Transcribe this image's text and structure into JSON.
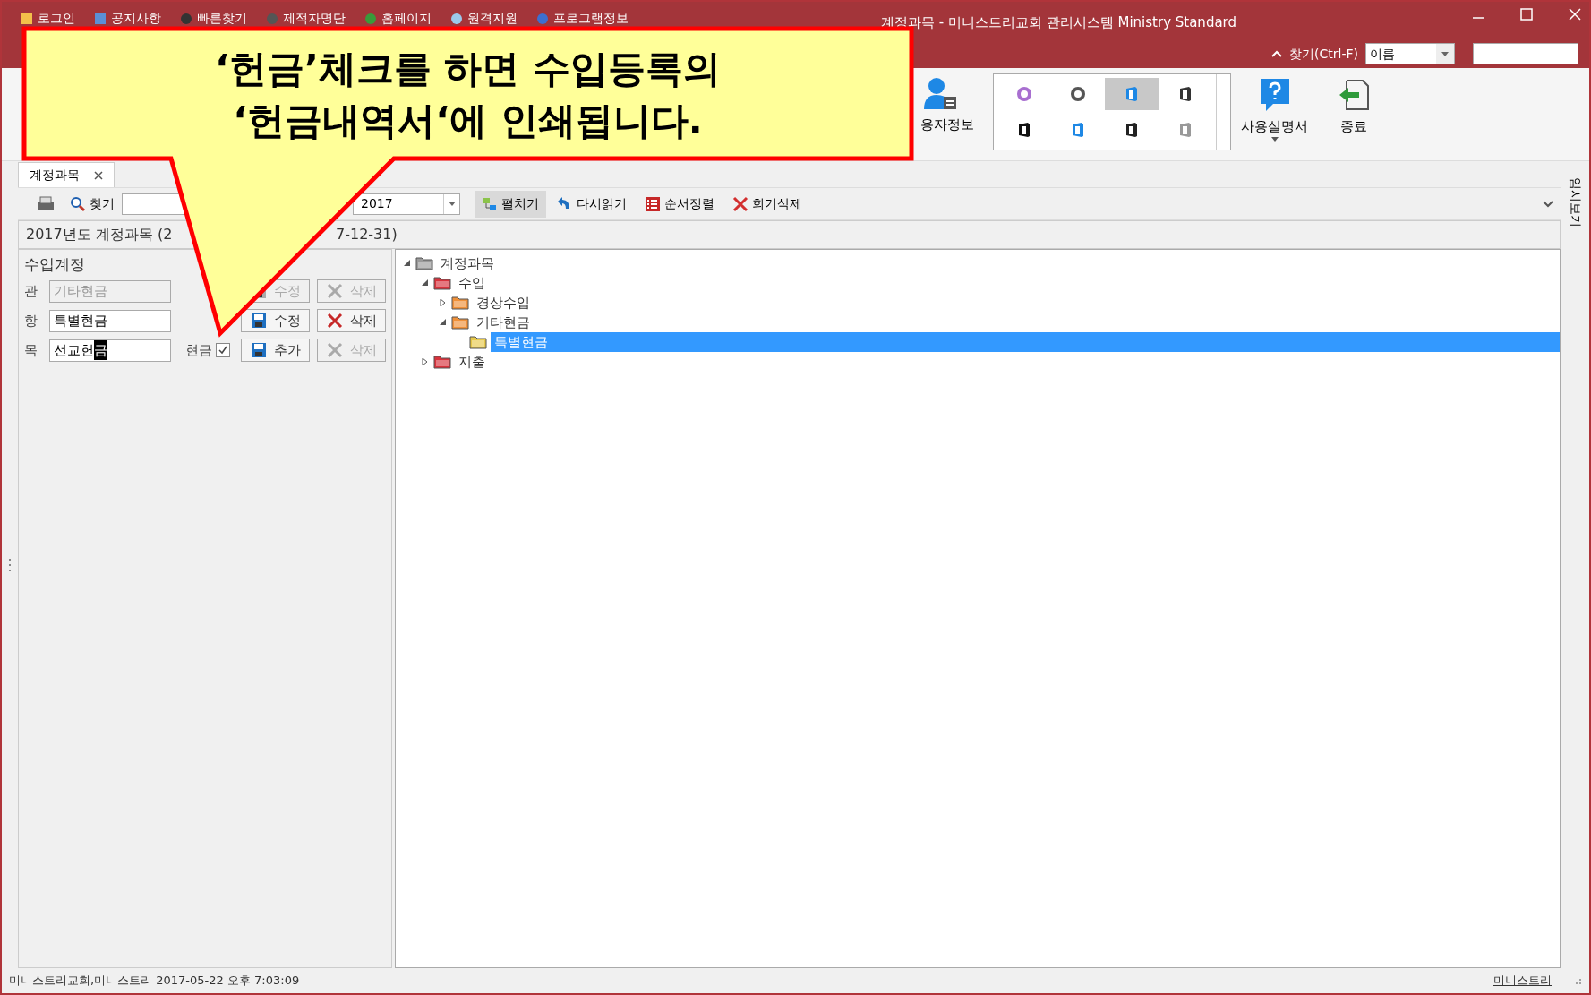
{
  "window": {
    "title": "계정과목 - 미니스트리교회 관리시스템 Ministry Standard"
  },
  "menu": [
    {
      "label": "로그인"
    },
    {
      "label": "공지사항"
    },
    {
      "label": "빠른찾기"
    },
    {
      "label": "제적자명단"
    },
    {
      "label": "홈페이지"
    },
    {
      "label": "원격지원"
    },
    {
      "label": "프로그램정보"
    }
  ],
  "quick_search": {
    "label": "찾기(Ctrl-F)",
    "field": "이름"
  },
  "ribbon": {
    "user_info": "용자정보",
    "themes": [
      {
        "selected": false
      },
      {
        "selected": false
      },
      {
        "selected": true
      },
      {
        "selected": false
      },
      {
        "selected": false
      },
      {
        "selected": false
      },
      {
        "selected": false
      },
      {
        "selected": false
      }
    ],
    "help": "사용설명서",
    "exit": "종료"
  },
  "tabs": [
    {
      "label": "계정과목",
      "selected": true
    }
  ],
  "toolbar": {
    "find": "찾기",
    "year": "2017",
    "buttons": [
      {
        "label": "펼치기",
        "kind": "expand",
        "pressed": true
      },
      {
        "label": "다시읽기",
        "kind": "reload",
        "pressed": false
      },
      {
        "label": "순서정렬",
        "kind": "sort",
        "pressed": false
      },
      {
        "label": "회기삭제",
        "kind": "delete",
        "pressed": false
      }
    ]
  },
  "header": [
    "2017년도 계정과목 (2",
    "7-12-31)"
  ],
  "form": {
    "title": "수입계정",
    "rows": [
      {
        "label": "관",
        "value": "기타현금",
        "disabled": true,
        "buttons": [
          {
            "label": "수정",
            "kind": "save",
            "disabled": true
          },
          {
            "label": "삭제",
            "kind": "delete",
            "disabled": true
          }
        ]
      },
      {
        "label": "항",
        "value": "특별현금",
        "disabled": false,
        "buttons": [
          {
            "label": "수정",
            "kind": "save",
            "disabled": false
          },
          {
            "label": "삭제",
            "kind": "delete",
            "disabled": false
          }
        ]
      },
      {
        "label": "목",
        "value": "선교헌",
        "selection": "금",
        "disabled": false,
        "cash": {
          "label": "현금",
          "checked": true
        },
        "buttons": [
          {
            "label": "추가",
            "kind": "save",
            "disabled": false
          },
          {
            "label": "삭제",
            "kind": "delete",
            "disabled": true
          }
        ]
      }
    ]
  },
  "tree": [
    {
      "label": "계정과목",
      "color": "#9a9a9a",
      "expanded": true,
      "selected": false,
      "children": [
        {
          "label": "수입",
          "color": "#d8323c",
          "expanded": true,
          "selected": false,
          "children": [
            {
              "label": "경상수입",
              "color": "#f0913a",
              "expanded": false,
              "selected": false
            },
            {
              "label": "기타현금",
              "color": "#f0913a",
              "expanded": true,
              "selected": false,
              "children": [
                {
                  "label": "특별현금",
                  "color": "#e6c84a",
                  "selected": true
                }
              ]
            }
          ]
        },
        {
          "label": "지출",
          "color": "#d8323c",
          "expanded": false,
          "selected": false
        }
      ]
    }
  ],
  "side_tab": "임시보기",
  "callout": [
    "‘헌금’체크를 하면 수입등록의",
    "‘헌금내역서‘에 인쇄됩니다."
  ],
  "status_bar": {
    "text": "미니스트리교회,미니스트리 2017-05-22 오후 7:03:09",
    "link": "미니스트리"
  }
}
